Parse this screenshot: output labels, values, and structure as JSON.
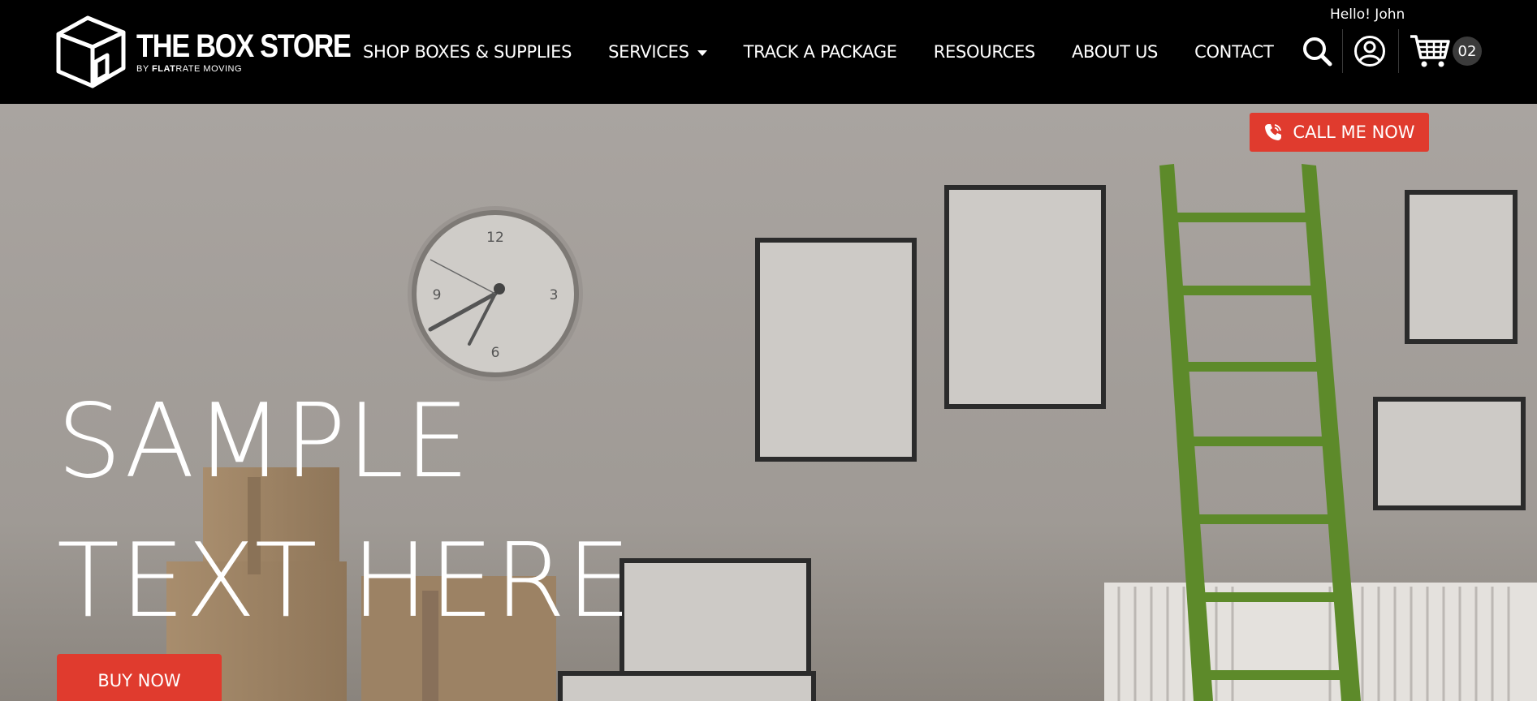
{
  "brand": {
    "name": "THE BOX STORE",
    "tagline_prefix": "BY ",
    "tagline_bold": "FLAT",
    "tagline_rest": "RATE MOVING"
  },
  "nav": {
    "items": [
      {
        "label": "SHOP BOXES & SUPPLIES"
      },
      {
        "label": "SERVICES"
      },
      {
        "label": "TRACK A PACKAGE"
      },
      {
        "label": "RESOURCES"
      },
      {
        "label": "ABOUT US"
      },
      {
        "label": "CONTACT"
      }
    ]
  },
  "header": {
    "greeting": "Hello! John",
    "search_icon": "search-icon",
    "user_icon": "user-circle-icon",
    "cart_icon": "cart-icon",
    "cart_count": "02"
  },
  "hero": {
    "call_button": "CALL ME NOW",
    "headline_line1": "SAMPLE",
    "headline_line2": "TEXT HERE",
    "buy_button": "BUY NOW"
  },
  "colors": {
    "header_bg": "#000000",
    "accent": "#e03b2e",
    "ladder": "#5d8a2a"
  }
}
